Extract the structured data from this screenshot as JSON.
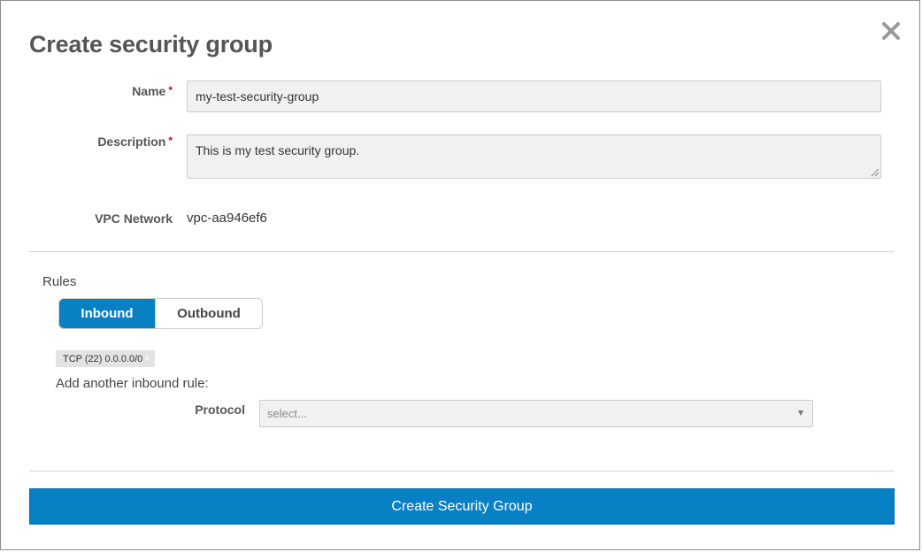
{
  "dialog": {
    "title": "Create security group",
    "close_icon": "close-icon"
  },
  "form": {
    "name": {
      "label": "Name",
      "required_mark": "*",
      "value": "my-test-security-group"
    },
    "description": {
      "label": "Description",
      "required_mark": "*",
      "value": "This is my test security group."
    },
    "vpc_network": {
      "label": "VPC Network",
      "value": "vpc-aa946ef6"
    }
  },
  "rules": {
    "label": "Rules",
    "tabs": [
      {
        "label": "Inbound",
        "selected": true
      },
      {
        "label": "Outbound",
        "selected": false
      }
    ],
    "existing_rules": [
      {
        "label": "TCP (22) 0.0.0.0/0",
        "remove_icon": "×"
      }
    ],
    "add_rule_label": "Add another inbound rule:",
    "protocol": {
      "label": "Protocol",
      "placeholder": "select..."
    }
  },
  "submit": {
    "label": "Create Security Group"
  },
  "colors": {
    "accent": "#0880c4",
    "required": "#a51c1c",
    "input_bg": "#f1f1f1"
  }
}
